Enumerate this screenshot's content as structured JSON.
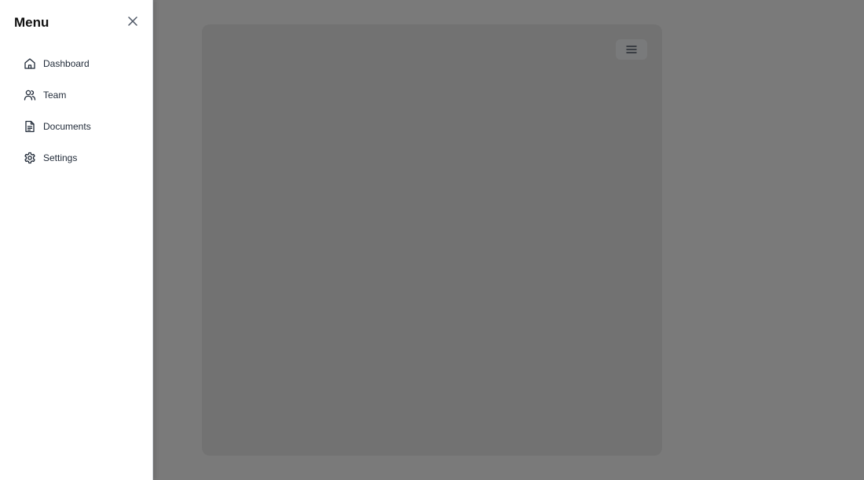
{
  "drawer": {
    "title": "Menu",
    "close_icon": "close-icon",
    "items": [
      {
        "label": "Dashboard",
        "icon": "home-icon"
      },
      {
        "label": "Team",
        "icon": "users-icon"
      },
      {
        "label": "Documents",
        "icon": "document-icon"
      },
      {
        "label": "Settings",
        "icon": "gear-icon"
      }
    ]
  },
  "main": {
    "menu_toggle_icon": "hamburger-icon"
  },
  "colors": {
    "overlay": "#000000",
    "drawer_bg": "#ffffff",
    "text": "#1f2937"
  }
}
